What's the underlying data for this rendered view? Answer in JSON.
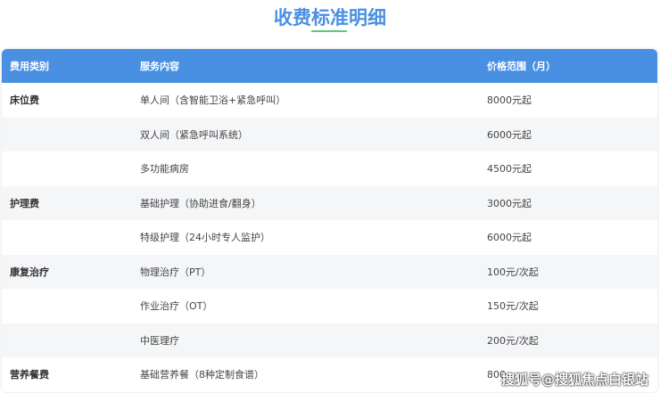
{
  "title": "收费标准明细",
  "headers": [
    "费用类别",
    "服务内容",
    "价格范围（月）"
  ],
  "rows": [
    {
      "category": "床位费",
      "service": "单人间（含智能卫浴+紧急呼叫）",
      "price": "8000元起"
    },
    {
      "category": "",
      "service": "双人间（紧急呼叫系统）",
      "price": "6000元起"
    },
    {
      "category": "",
      "service": "多功能病房",
      "price": "4500元起"
    },
    {
      "category": "护理费",
      "service": "基础护理（协助进食/翻身）",
      "price": "3000元起"
    },
    {
      "category": "",
      "service": "特级护理（24小时专人监护）",
      "price": "6000元起"
    },
    {
      "category": "康复治疗",
      "service": "物理治疗（PT）",
      "price": "100元/次起"
    },
    {
      "category": "",
      "service": "作业治疗（OT）",
      "price": "150元/次起"
    },
    {
      "category": "",
      "service": "中医理疗",
      "price": "200元/次起"
    },
    {
      "category": "营养餐费",
      "service": "基础营养餐（8种定制食谱）",
      "price": "800-"
    }
  ],
  "watermark": "搜狐号@搜狐焦点白银站"
}
